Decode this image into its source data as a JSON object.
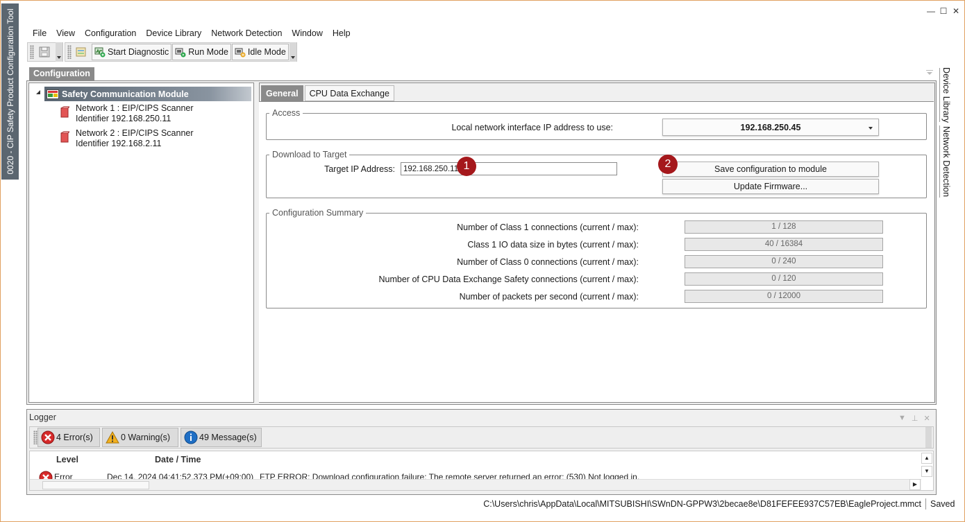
{
  "app": {
    "title": "0020 - CIP Safety Product Configuration Tool",
    "window_controls": {
      "minimize": "—",
      "maximize": "☐",
      "close": "✕"
    }
  },
  "menu": [
    "File",
    "View",
    "Configuration",
    "Device Library",
    "Network Detection",
    "Window",
    "Help"
  ],
  "toolbar": {
    "save_icon": "save-icon",
    "open_icon": "open-folder-icon",
    "start_diagnostic": "Start Diagnostic",
    "run_mode": "Run Mode",
    "idle_mode": "Idle Mode"
  },
  "config_panel": {
    "title": "Configuration"
  },
  "tree": {
    "root": "Safety Communication Module",
    "nodes": [
      {
        "line1": "Network 1 : EIP/CIPS Scanner",
        "line2": "Identifier 192.168.250.11"
      },
      {
        "line1": "Network 2 : EIP/CIPS Scanner",
        "line2": "Identifier 192.168.2.11"
      }
    ]
  },
  "tabs": {
    "general": "General",
    "cpu": "CPU Data Exchange"
  },
  "access": {
    "legend": "Access",
    "label": "Local network interface IP address to use:",
    "value": "192.168.250.45"
  },
  "download": {
    "legend": "Download to Target",
    "target_label": "Target IP Address:",
    "target_value": "192.168.250.11",
    "save_button": "Save configuration to module",
    "update_button": "Update Firmware...",
    "badge1": "1",
    "badge2": "2"
  },
  "summary": {
    "legend": "Configuration Summary",
    "rows": [
      {
        "label": "Number of Class 1 connections (current / max):",
        "value": "1 / 128"
      },
      {
        "label": "Class 1 IO data size in bytes (current / max):",
        "value": "40 / 16384"
      },
      {
        "label": "Number of Class 0 connections (current / max):",
        "value": "0 / 240"
      },
      {
        "label": "Number of CPU Data Exchange Safety connections (current / max):",
        "value": "0 / 120"
      },
      {
        "label": "Number of packets per second (current / max):",
        "value": "0 / 12000"
      }
    ]
  },
  "dock": {
    "device_library": "Device Library",
    "network_detection": "Network Detection"
  },
  "logger": {
    "title": "Logger",
    "errors": "4 Error(s)",
    "warnings": "0 Warning(s)",
    "messages": "49 Message(s)",
    "col_level": "Level",
    "col_datetime": "Date / Time",
    "row": {
      "level": "Error",
      "datetime": "Dec 14, 2024 04:41:52.373 PM(+09:00)",
      "message": "FTP ERROR: Download configuration failure: The remote server returned an error: (530) Not logged in."
    }
  },
  "status": {
    "path": "C:\\Users\\chris\\AppData\\Local\\MITSUBISHI\\SWnDN-GPPW3\\2becae8e\\D81FEFEE937C57EB\\EagleProject.mmct",
    "saved": "Saved"
  }
}
